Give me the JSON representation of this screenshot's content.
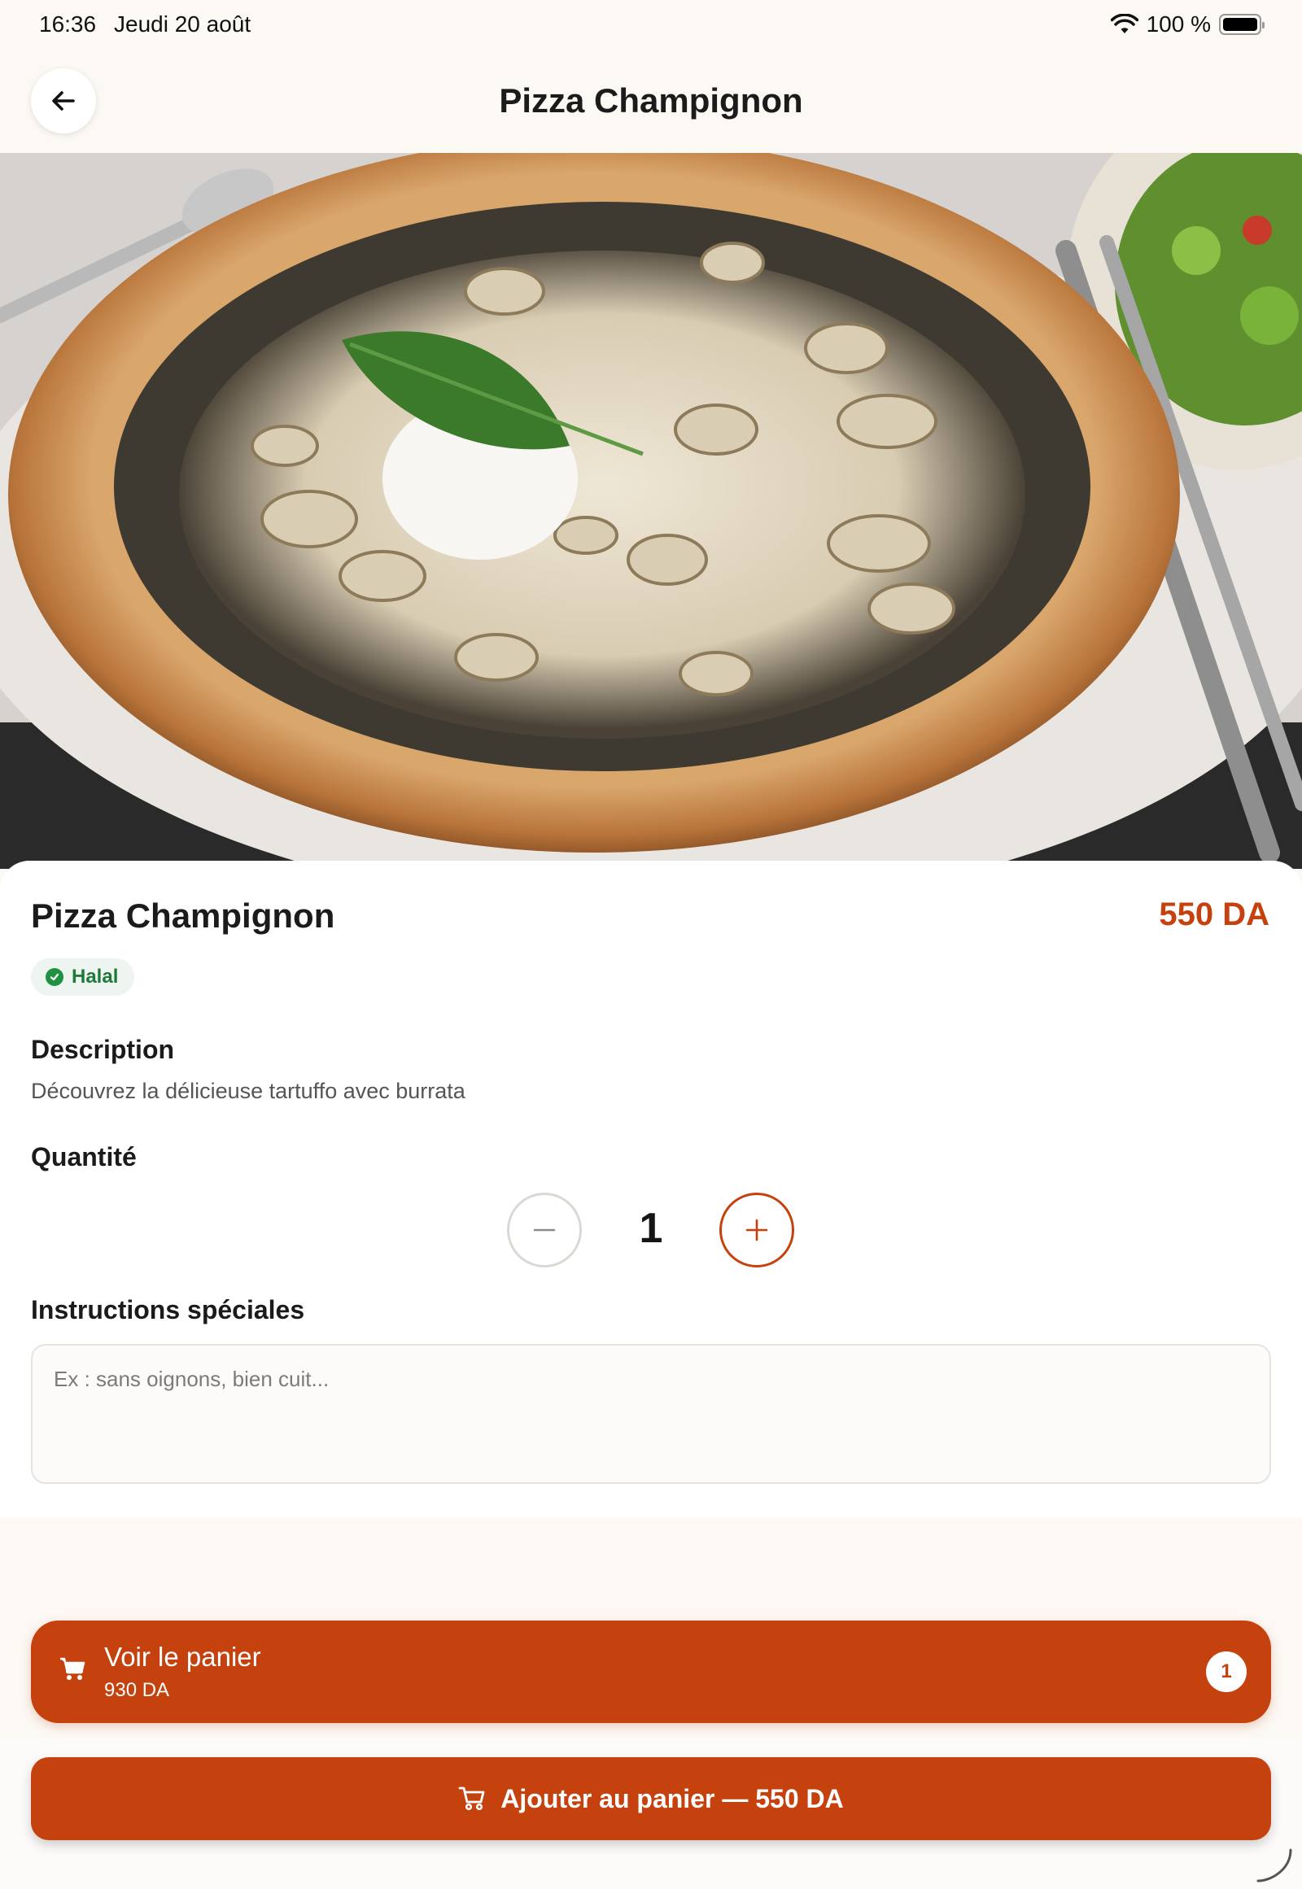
{
  "status_bar": {
    "time": "16:36",
    "date": "Jeudi 20 août",
    "battery": "100 %",
    "wifi_icon": "wifi-icon",
    "battery_icon": "battery-icon"
  },
  "header": {
    "title": "Pizza Champignon",
    "back_icon": "arrow-left-icon"
  },
  "hero": {
    "image": "pizza-champignon-photo"
  },
  "item": {
    "name": "Pizza Champignon",
    "price": "550 DA",
    "badge": "Halal"
  },
  "description": {
    "label": "Description",
    "text": "Découvrez la délicieuse tartuffo avec burrata"
  },
  "quantity": {
    "label": "Quantité",
    "value": "1",
    "minus_icon": "minus-icon",
    "plus_icon": "plus-icon"
  },
  "instructions": {
    "label": "Instructions spéciales",
    "placeholder": "Ex : sans oignons, bien cuit...",
    "value": ""
  },
  "cart": {
    "title": "Voir le panier",
    "total": "930 DA",
    "count": "1",
    "icon": "cart-icon"
  },
  "add_button": {
    "label": "Ajouter au panier — 550 DA",
    "icon": "cart-icon"
  },
  "colors": {
    "accent": "#c5410e",
    "background": "#fcf8f4",
    "halal_green": "#1f9142"
  }
}
